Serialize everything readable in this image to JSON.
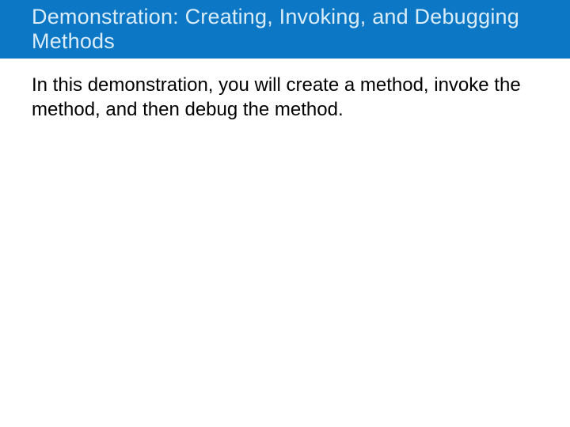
{
  "slide": {
    "title": "Demonstration: Creating, Invoking, and Debugging Methods",
    "body": "In this demonstration, you will create a method, invoke the method, and then debug the method."
  }
}
